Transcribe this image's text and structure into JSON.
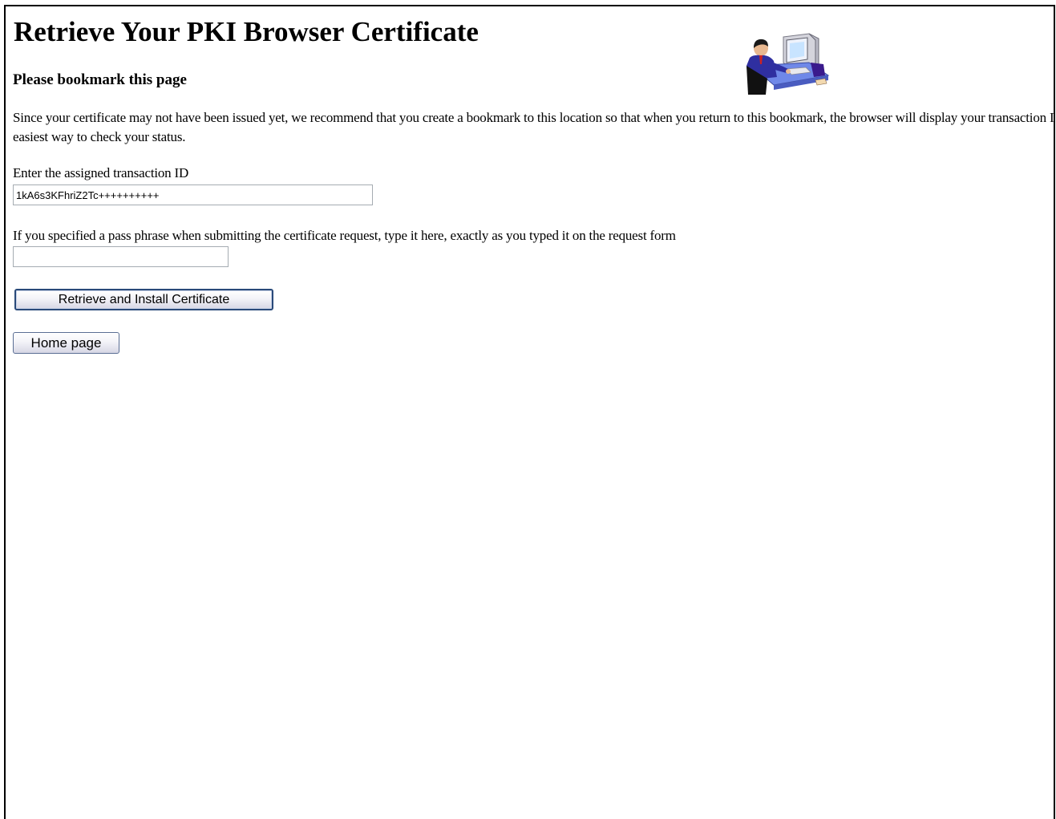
{
  "page": {
    "title": "Retrieve Your PKI Browser Certificate",
    "subtitle": "Please bookmark this page",
    "intro": "Since your certificate may not have been issued yet, we recommend that you create a bookmark to this location so that when you return to this bookmark, the browser will display your transaction ID. This is the easiest way to check your status.",
    "illustration_icon": "person-at-computer-icon"
  },
  "form": {
    "transaction_id": {
      "label": "Enter the assigned transaction ID",
      "value": "1kA6s3KFhriZ2Tc++++++++++"
    },
    "pass_phrase": {
      "label": "If you specified a pass phrase when submitting the certificate request, type it here, exactly as you typed it on the request form",
      "value": ""
    },
    "retrieve_button_label": "Retrieve and Install Certificate",
    "home_button_label": "Home page"
  },
  "colors": {
    "button_border": "#2a4a7a",
    "illustration_desk": "#6f88e8",
    "illustration_shirt": "#2f2fa0"
  }
}
